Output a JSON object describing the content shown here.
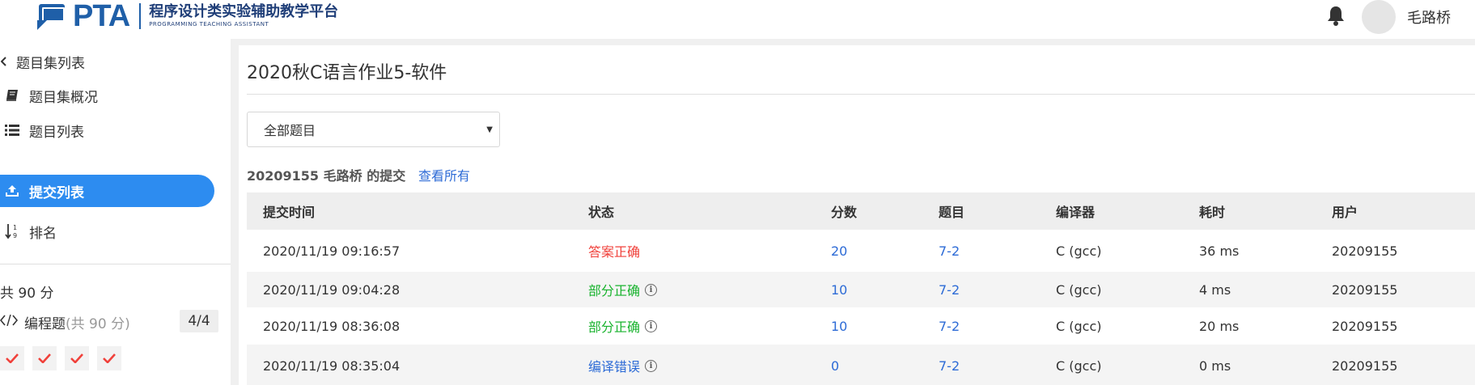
{
  "header": {
    "logo_text": "PTA",
    "logo_subtitle_cn": "程序设计类实验辅助教学平台",
    "logo_subtitle_en": "PROGRAMMING TEACHING ASSISTANT",
    "username": "毛路桥",
    "icons": [
      "bell-icon",
      "avatar"
    ]
  },
  "sidebar": {
    "items": [
      {
        "label": "题目集列表",
        "icon": "chevron-left-icon"
      },
      {
        "label": "题目集概况",
        "icon": "book-icon"
      },
      {
        "label": "题目列表",
        "icon": "list-icon"
      },
      {
        "label": "提交列表",
        "icon": "upload-icon",
        "active": true
      },
      {
        "label": "排名",
        "icon": "sort-numeric-icon"
      }
    ],
    "total": "共 90 分",
    "programming": {
      "label": "编程题",
      "points": "(共 90 分)",
      "count": "4/4"
    },
    "checks": 4
  },
  "main": {
    "title": "2020秋C语言作业5-软件",
    "filter": {
      "selected": "全部题目"
    },
    "sub_heading": "20209155 毛路桥 的提交",
    "view_all": "查看所有",
    "columns": [
      "提交时间",
      "状态",
      "分数",
      "题目",
      "编译器",
      "耗时",
      "用户"
    ],
    "rows": [
      {
        "time": "2020/11/19 09:16:57",
        "status": "答案正确",
        "status_type": "ok",
        "score": "20",
        "problem": "7-2",
        "compiler": "C (gcc)",
        "elapsed": "36 ms",
        "user": "20209155"
      },
      {
        "time": "2020/11/19 09:04:28",
        "status": "部分正确",
        "status_type": "partial",
        "score": "10",
        "problem": "7-2",
        "compiler": "C (gcc)",
        "elapsed": "4 ms",
        "user": "20209155"
      },
      {
        "time": "2020/11/19 08:36:08",
        "status": "部分正确",
        "status_type": "partial",
        "score": "10",
        "problem": "7-2",
        "compiler": "C (gcc)",
        "elapsed": "20 ms",
        "user": "20209155"
      },
      {
        "time": "2020/11/19 08:35:04",
        "status": "编译错误",
        "status_type": "cerr",
        "score": "0",
        "problem": "7-2",
        "compiler": "C (gcc)",
        "elapsed": "0 ms",
        "user": "20209155"
      }
    ]
  },
  "colors": {
    "accent": "#2d8cf0",
    "ok": "#f0413b",
    "partial": "#19b32e",
    "link": "#2d6bd6",
    "brand": "#1f5fa8"
  }
}
